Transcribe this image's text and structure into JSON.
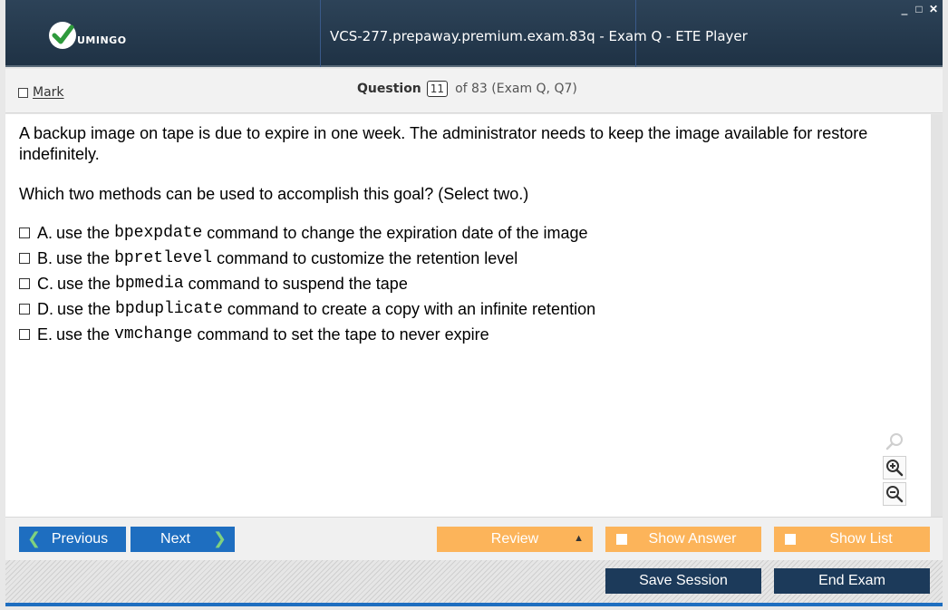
{
  "app": {
    "logo_text": "UMINGO",
    "window_title": "VCS-277.prepaway.premium.exam.83q - Exam Q - ETE Player",
    "window_controls": [
      "minimize-icon",
      "maximize-icon",
      "close-icon"
    ]
  },
  "header": {
    "mark_label": "Mark",
    "question_label": "Question",
    "question_number": "11",
    "question_of": "of 83 (Exam Q, Q7)"
  },
  "question": {
    "stem": "A backup image on tape is due to expire in one week. The administrator needs to keep the image available for restore indefinitely.",
    "prompt": "Which two methods can be used to accomplish this goal? (Select two.)",
    "choices": [
      {
        "letter": "A.",
        "pre": "use the ",
        "cmd": "bpexpdate",
        "post": " command to change the expiration date of the image"
      },
      {
        "letter": "B.",
        "pre": "use the ",
        "cmd": "bpretlevel",
        "post": " command to customize the retention level"
      },
      {
        "letter": "C.",
        "pre": "use the ",
        "cmd": "bpmedia",
        "post": " command to suspend the tape"
      },
      {
        "letter": "D.",
        "pre": "use the ",
        "cmd": "bpduplicate",
        "post": " command to create a copy with an infinite retention"
      },
      {
        "letter": "E.",
        "pre": "use the ",
        "cmd": "vmchange",
        "post": " command to set the tape to never expire"
      }
    ]
  },
  "zoom": {
    "icons": [
      "search-icon",
      "zoom-in-icon",
      "zoom-out-icon"
    ]
  },
  "nav": {
    "previous": "Previous",
    "next": "Next",
    "review": "Review",
    "show_answer": "Show Answer",
    "show_list": "Show List"
  },
  "footer": {
    "save_session": "Save Session",
    "end_exam": "End Exam"
  },
  "colors": {
    "titlebar": "#1f3245",
    "primary_blue": "#1e6ec0",
    "orange": "#fcb45a",
    "dark_button": "#1c3a5a",
    "logo_green": "#2e9a3c"
  }
}
